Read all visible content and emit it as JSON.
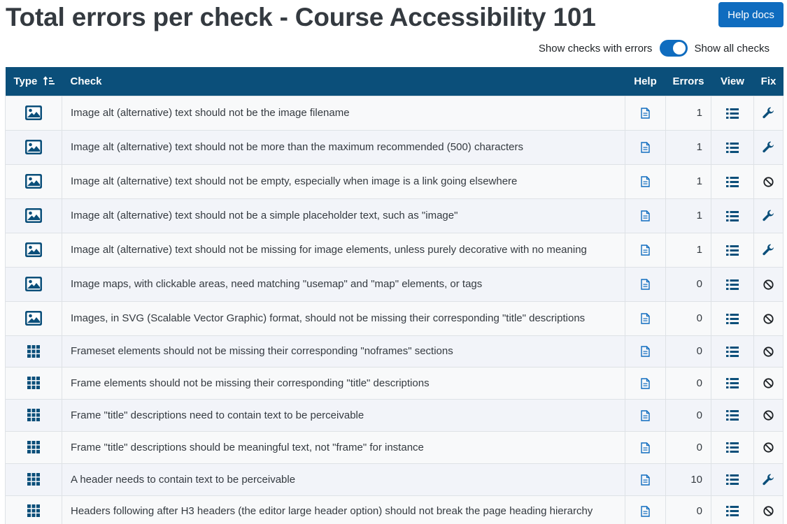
{
  "page": {
    "title": "Total errors per check - Course Accessibility 101",
    "help_button": "Help docs",
    "toggle_left_label": "Show checks with errors",
    "toggle_right_label": "Show all checks",
    "toggle_state": "show-all-checks"
  },
  "colors": {
    "primary": "#0f6cbf",
    "header_bg": "#0b4f7a",
    "icon_blue": "#0b4f7a",
    "text": "#343a40"
  },
  "table": {
    "columns": {
      "type": "Type",
      "check": "Check",
      "help": "Help",
      "errors": "Errors",
      "view": "View",
      "fix": "Fix"
    },
    "sort_icon": "sort-ascending-icon",
    "rows": [
      {
        "type": "image",
        "check": "Image alt (alternative) text should not be the image filename",
        "errors": "1",
        "fix": "wrench"
      },
      {
        "type": "image",
        "check": "Image alt (alternative) text should not be more than the maximum recommended (500) characters",
        "errors": "1",
        "fix": "wrench"
      },
      {
        "type": "image",
        "check": "Image alt (alternative) text should not be empty, especially when image is a link going elsewhere",
        "errors": "1",
        "fix": "ban"
      },
      {
        "type": "image",
        "check": "Image alt (alternative) text should not be a simple placeholder text, such as \"image\"",
        "errors": "1",
        "fix": "wrench"
      },
      {
        "type": "image",
        "check": "Image alt (alternative) text should not be missing for image elements, unless purely decorative with no meaning",
        "errors": "1",
        "fix": "wrench"
      },
      {
        "type": "image",
        "check": "Image maps, with clickable areas, need matching \"usemap\" and \"map\" elements, or tags",
        "errors": "0",
        "fix": "ban"
      },
      {
        "type": "image",
        "check": "Images, in SVG (Scalable Vector Graphic) format, should not be missing their corresponding \"title\" descriptions",
        "errors": "0",
        "fix": "ban"
      },
      {
        "type": "layout",
        "check": "Frameset elements should not be missing their corresponding \"noframes\" sections",
        "errors": "0",
        "fix": "ban"
      },
      {
        "type": "layout",
        "check": "Frame elements should not be missing their corresponding \"title\" descriptions",
        "errors": "0",
        "fix": "ban"
      },
      {
        "type": "layout",
        "check": "Frame \"title\" descriptions need to contain text to be perceivable",
        "errors": "0",
        "fix": "ban"
      },
      {
        "type": "layout",
        "check": "Frame \"title\" descriptions should be meaningful text, not \"frame\" for instance",
        "errors": "0",
        "fix": "ban"
      },
      {
        "type": "layout",
        "check": "A header needs to contain text to be perceivable",
        "errors": "10",
        "fix": "wrench"
      },
      {
        "type": "layout",
        "check": "Headers following after H3 headers (the editor large header option) should not break the page heading hierarchy",
        "errors": "0",
        "fix": "ban"
      }
    ]
  }
}
